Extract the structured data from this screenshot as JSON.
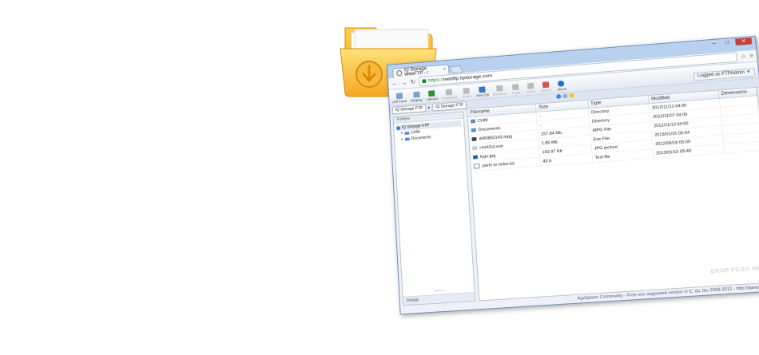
{
  "colors": {
    "folder": "#f5a623",
    "accent": "#3a78c3",
    "close": "#c7403a",
    "https": "#1b8a2a"
  },
  "browser": {
    "tab_title": "iQ Storage WebFTP - /",
    "url_scheme": "https://",
    "url_host": "webftp.iqstorage.com"
  },
  "toolbar": {
    "buttons": [
      {
        "label": "Left Pane",
        "icon": "left-pane-icon",
        "enabled": true
      },
      {
        "label": "Display",
        "icon": "display-icon",
        "enabled": true
      },
      {
        "label": "Upload",
        "icon": "upload-icon",
        "enabled": true
      },
      {
        "label": "Download",
        "icon": "download-icon",
        "enabled": false
      },
      {
        "label": "Share",
        "icon": "share-icon",
        "enabled": false
      },
      {
        "label": "New Dir",
        "icon": "new-folder-icon",
        "enabled": true
      },
      {
        "label": "Rename",
        "icon": "rename-icon",
        "enabled": false
      },
      {
        "label": "Copy",
        "icon": "copy-icon",
        "enabled": false
      },
      {
        "label": "Move",
        "icon": "move-icon",
        "enabled": false
      },
      {
        "label": "Delete",
        "icon": "delete-icon",
        "enabled": false
      },
      {
        "label": "About",
        "icon": "info-icon",
        "enabled": true
      }
    ],
    "login_label": "Logged as FTPAdmin"
  },
  "breadcrumb": [
    "iQ Storage FTP",
    "iQ Storage FTP"
  ],
  "sidebar": {
    "header": "Folders",
    "root": "iQ Storage FTP",
    "children": [
      "CHM",
      "Documents"
    ],
    "details_label": "Details"
  },
  "file_list": {
    "columns": [
      "Filename",
      "Size",
      "Type",
      "Modified",
      "Dimensions"
    ],
    "rows": [
      {
        "name": "CHM",
        "size": "-",
        "type": "Directory",
        "modified": "2012/11/13 04:00",
        "dims": "",
        "icon": "folder-icon"
      },
      {
        "name": "Documents",
        "size": "-",
        "type": "Directory",
        "modified": "2012/11/07 04:00",
        "dims": "",
        "icon": "folder-icon"
      },
      {
        "name": "dr85882143.mpg",
        "size": "157.84 Mb",
        "type": "MPG File",
        "modified": "2012/11/13 04:00",
        "dims": "",
        "icon": "video-icon"
      },
      {
        "name": "ces42ut.exe",
        "size": "1.85 Mb",
        "type": "Exe File",
        "modified": "2013/01/15 05:54",
        "dims": "",
        "icon": "exe-icon"
      },
      {
        "name": "logo.jpg",
        "size": "169.97 Kb",
        "type": "JPG picture",
        "modified": "2012/09/18 05:00",
        "dims": "",
        "icon": "image-icon"
      },
      {
        "name": "parts to order.txt",
        "size": "43 b",
        "type": "Text file",
        "modified": "2013/01/15 05:49",
        "dims": "",
        "icon": "text-file-icon"
      }
    ]
  },
  "dropzone_text": "DROP FILES HERE",
  "footer_text": "AjaXplorer Community - Free non supported version © C. du Jeu 2008-2012 - http://ajaxplorer.info/"
}
